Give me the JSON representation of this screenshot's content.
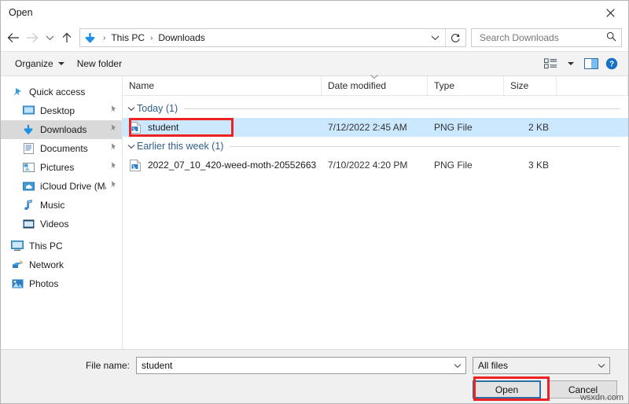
{
  "window": {
    "title": "Open",
    "close_icon": "close-icon"
  },
  "nav": {
    "back_icon": "arrow-left-icon",
    "forward_icon": "arrow-right-icon",
    "recent_icon": "chevron-down-icon",
    "up_icon": "arrow-up-icon",
    "address_icon": "download-arrow-icon",
    "breadcrumbs": [
      "This PC",
      "Downloads"
    ],
    "separator": "›",
    "dropdown_icon": "chevron-down-icon",
    "refresh_icon": "refresh-icon"
  },
  "search": {
    "placeholder": "Search Downloads",
    "value": "",
    "icon": "search-icon"
  },
  "toolbar": {
    "organize_label": "Organize",
    "new_folder_label": "New folder",
    "view_icon": "list-view-icon",
    "view_caret_icon": "chevron-down-icon",
    "preview_pane_icon": "preview-pane-icon",
    "help_icon": "help-circle-icon"
  },
  "sidebar": {
    "items": [
      {
        "label": "Quick access",
        "icon": "star-pin-icon",
        "level": 0,
        "pinned": false,
        "selected": false
      },
      {
        "label": "Desktop",
        "icon": "desktop-icon",
        "level": 1,
        "pinned": true,
        "selected": false
      },
      {
        "label": "Downloads",
        "icon": "download-arrow-icon",
        "level": 1,
        "pinned": true,
        "selected": true
      },
      {
        "label": "Documents",
        "icon": "documents-icon",
        "level": 1,
        "pinned": true,
        "selected": false
      },
      {
        "label": "Pictures",
        "icon": "pictures-icon",
        "level": 1,
        "pinned": true,
        "selected": false
      },
      {
        "label": "iCloud Drive (Ma",
        "icon": "icloud-drive-icon",
        "level": 1,
        "pinned": true,
        "selected": false
      },
      {
        "label": "Music",
        "icon": "music-note-icon",
        "level": 1,
        "pinned": false,
        "selected": false
      },
      {
        "label": "Videos",
        "icon": "videos-icon",
        "level": 1,
        "pinned": false,
        "selected": false
      },
      {
        "label": "This PC",
        "icon": "this-pc-icon",
        "level": 0,
        "pinned": false,
        "selected": false
      },
      {
        "label": "Network",
        "icon": "network-icon",
        "level": 0,
        "pinned": false,
        "selected": false
      },
      {
        "label": "Photos",
        "icon": "photos-icon",
        "level": 0,
        "pinned": false,
        "selected": false
      }
    ]
  },
  "filelist": {
    "columns": [
      "Name",
      "Date modified",
      "Type",
      "Size"
    ],
    "sort_indicator_column": "Date modified",
    "groups": [
      {
        "title": "Today (1)",
        "chevron_icon": "chevron-down-icon",
        "rows": [
          {
            "name": "student",
            "date_modified": "7/12/2022 2:45 AM",
            "type": "PNG File",
            "size": "2 KB",
            "icon": "png-file-icon",
            "selected": true
          }
        ]
      },
      {
        "title": "Earlier this week (1)",
        "chevron_icon": "chevron-down-icon",
        "rows": [
          {
            "name": "2022_07_10_420-weed-moth-20552663",
            "date_modified": "7/10/2022 4:20 PM",
            "type": "PNG File",
            "size": "3 KB",
            "icon": "png-file-icon",
            "selected": false
          }
        ]
      }
    ]
  },
  "footer": {
    "filename_label": "File name:",
    "filename_value": "student",
    "filename_caret_icon": "chevron-down-icon",
    "filter_value": "All files",
    "filter_caret_icon": "chevron-down-icon",
    "open_label": "Open",
    "cancel_label": "Cancel"
  },
  "watermark": "wsxdn.com",
  "colors": {
    "selection": "#cce8ff",
    "sidebar_selection": "#d9d9d9",
    "group_header": "#2e5d8a",
    "accent_blue": "#2f6fa8",
    "annotation_red": "#ee2222",
    "download_arrow": "#1e90e8"
  }
}
